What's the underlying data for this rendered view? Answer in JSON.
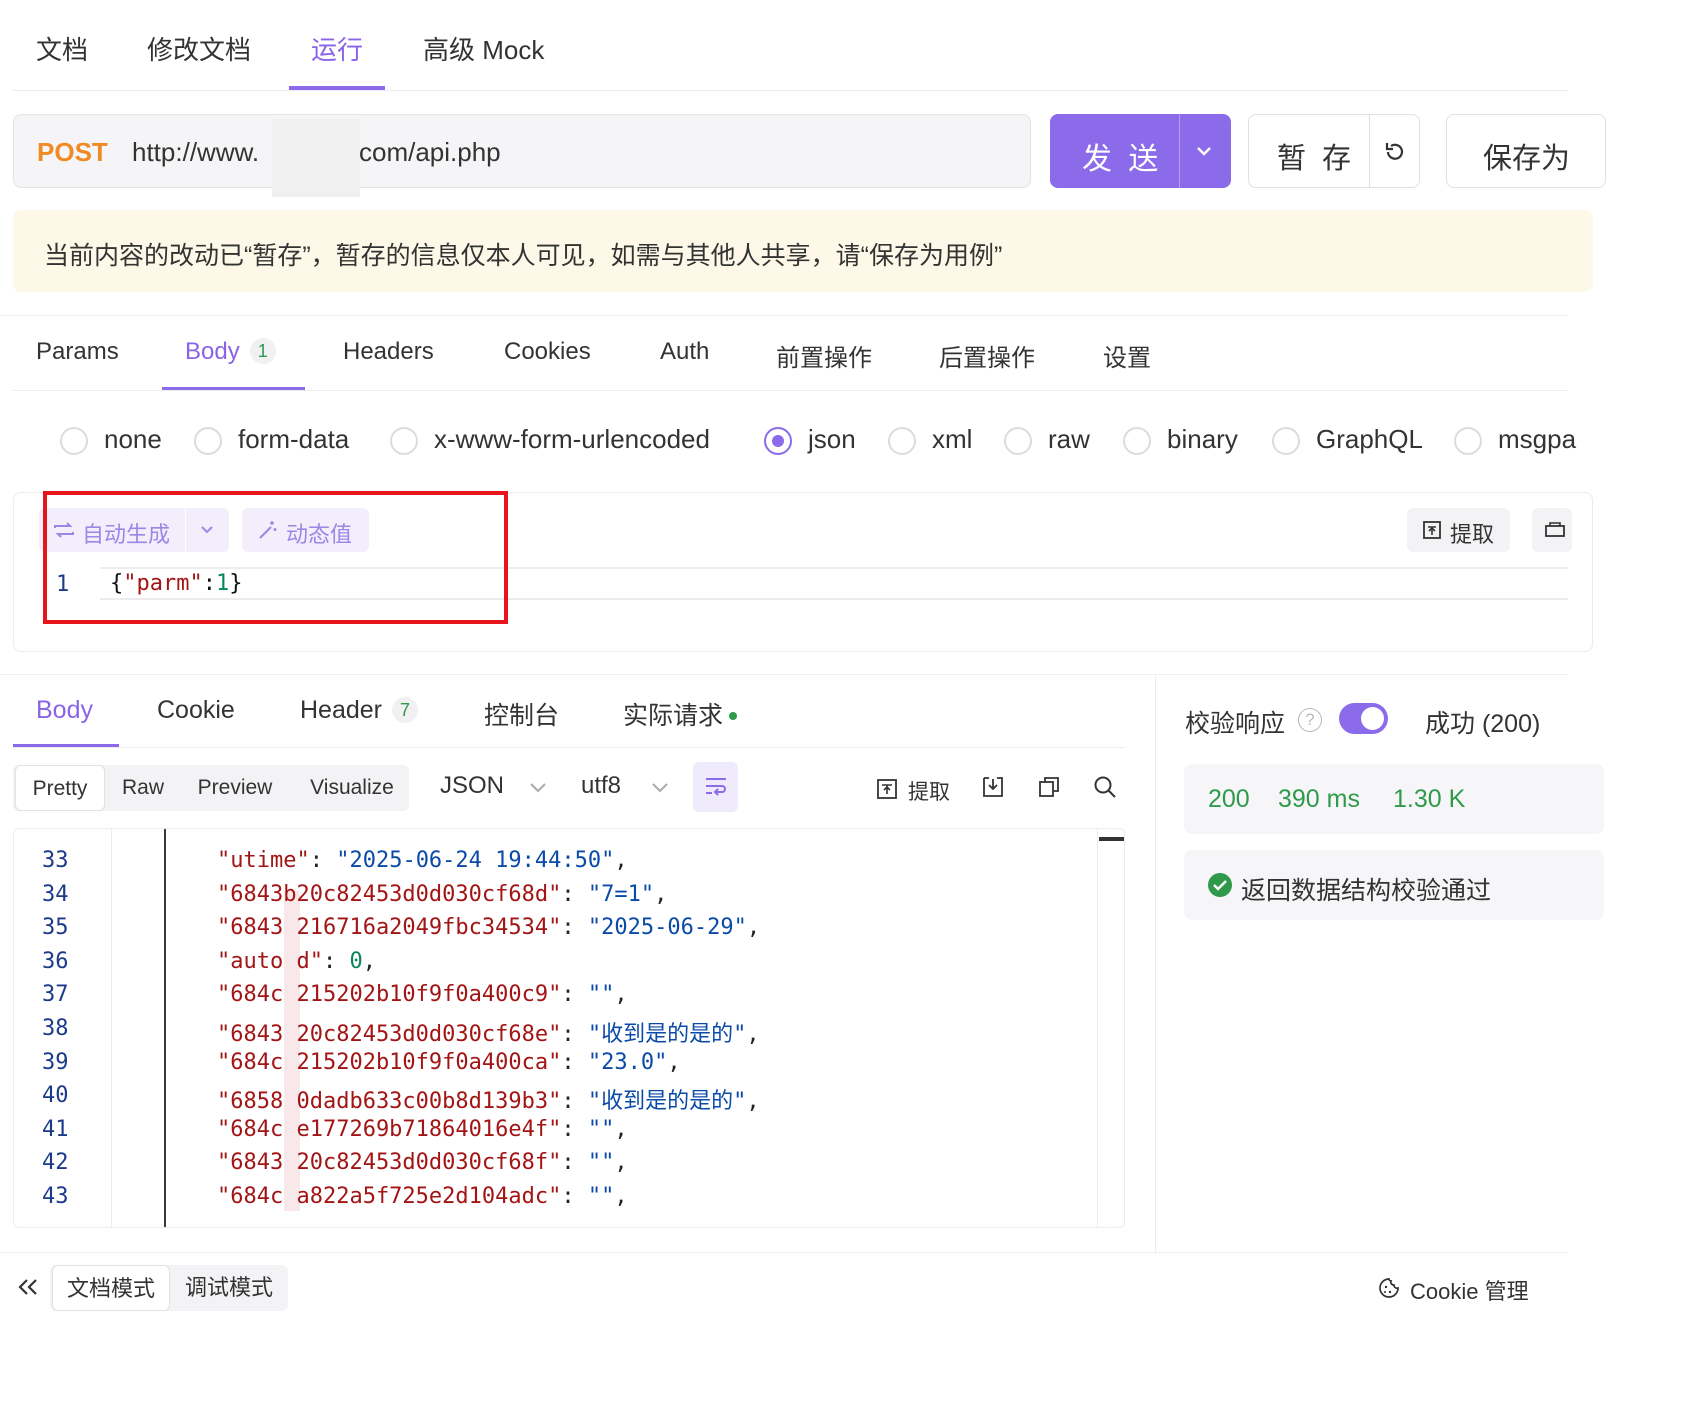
{
  "top_tabs": [
    {
      "label": "文档"
    },
    {
      "label": "修改文档"
    },
    {
      "label": "运行"
    },
    {
      "label": "高级 Mock"
    }
  ],
  "request": {
    "method": "POST",
    "url_prefix": "http://www.",
    "url_suffix": "com/api.php",
    "send_label": "发 送",
    "stash_label": "暂 存",
    "save_as_label": "保存为"
  },
  "notice": {
    "text": "当前内容的改动已“暂存”，暂存的信息仅本人可见，如需与其他人共享，请“保存为用例”"
  },
  "request_tabs": [
    {
      "label": "Params"
    },
    {
      "label": "Body",
      "badge": "1"
    },
    {
      "label": "Headers"
    },
    {
      "label": "Cookies"
    },
    {
      "label": "Auth"
    },
    {
      "label": "前置操作"
    },
    {
      "label": "后置操作"
    },
    {
      "label": "设置"
    }
  ],
  "body_types": [
    {
      "label": "none"
    },
    {
      "label": "form-data"
    },
    {
      "label": "x-www-form-urlencoded"
    },
    {
      "label": "json"
    },
    {
      "label": "xml"
    },
    {
      "label": "raw"
    },
    {
      "label": "binary"
    },
    {
      "label": "GraphQL"
    },
    {
      "label": "msgpa"
    }
  ],
  "editor": {
    "auto_generate_label": "自动生成",
    "dynamic_value_label": "动态值",
    "extract_label": "提取",
    "line_number": "1",
    "code_open": "{",
    "code_key": "\"parm\"",
    "code_colon": ":",
    "code_value": "1",
    "code_close": "}"
  },
  "response_tabs": [
    {
      "label": "Body"
    },
    {
      "label": "Cookie"
    },
    {
      "label": "Header",
      "badge": "7"
    },
    {
      "label": "控制台"
    },
    {
      "label": "实际请求"
    }
  ],
  "response_toolbar": {
    "formats": [
      "Pretty",
      "Raw",
      "Preview",
      "Visualize"
    ],
    "language": "JSON",
    "encoding": "utf8",
    "extract_label": "提取"
  },
  "response_lines": [
    {
      "no": "33",
      "key": "\"utime\"",
      "value": "\"2025-06-24 19:44:50\"",
      "type": "s"
    },
    {
      "no": "34",
      "key": "\"6843b20c82453d0d030cf68d\"",
      "value": "\"7=1\"",
      "type": "s"
    },
    {
      "no": "35",
      "key": "\"6843 216716a2049fbc34534\"",
      "value": "\"2025-06-29\"",
      "type": "s"
    },
    {
      "no": "36",
      "key": "\"auto d\"",
      "value": "0",
      "type": "n"
    },
    {
      "no": "37",
      "key": "\"684c 215202b10f9f0a400c9\"",
      "value": "\"\"",
      "type": "s"
    },
    {
      "no": "38",
      "key": "\"6843 20c82453d0d030cf68e\"",
      "value": "\"收到是的是的\"",
      "type": "s"
    },
    {
      "no": "39",
      "key": "\"684c 215202b10f9f0a400ca\"",
      "value": "\"23.0\"",
      "type": "s"
    },
    {
      "no": "40",
      "key": "\"6858 0dadb633c00b8d139b3\"",
      "value": "\"收到是的是的\"",
      "type": "s"
    },
    {
      "no": "41",
      "key": "\"684c e177269b71864016e4f\"",
      "value": "\"\"",
      "type": "s"
    },
    {
      "no": "42",
      "key": "\"6843 20c82453d0d030cf68f\"",
      "value": "\"\"",
      "type": "s"
    },
    {
      "no": "43",
      "key": "\"684c a822a5f725e2d104adc\"",
      "value": "\"\"",
      "type": "s"
    }
  ],
  "validation": {
    "label": "校验响应",
    "result": "成功 (200)",
    "status": "200",
    "time": "390 ms",
    "size": "1.30 K",
    "message": "返回数据结构校验通过"
  },
  "footer": {
    "doc_mode": "文档模式",
    "debug_mode": "调试模式",
    "cookie_manage": "Cookie 管理"
  },
  "colors": {
    "accent": "#8b6bea",
    "success": "#2e9a4a",
    "method": "#f08a24",
    "highlight_box": "#e8141c"
  }
}
